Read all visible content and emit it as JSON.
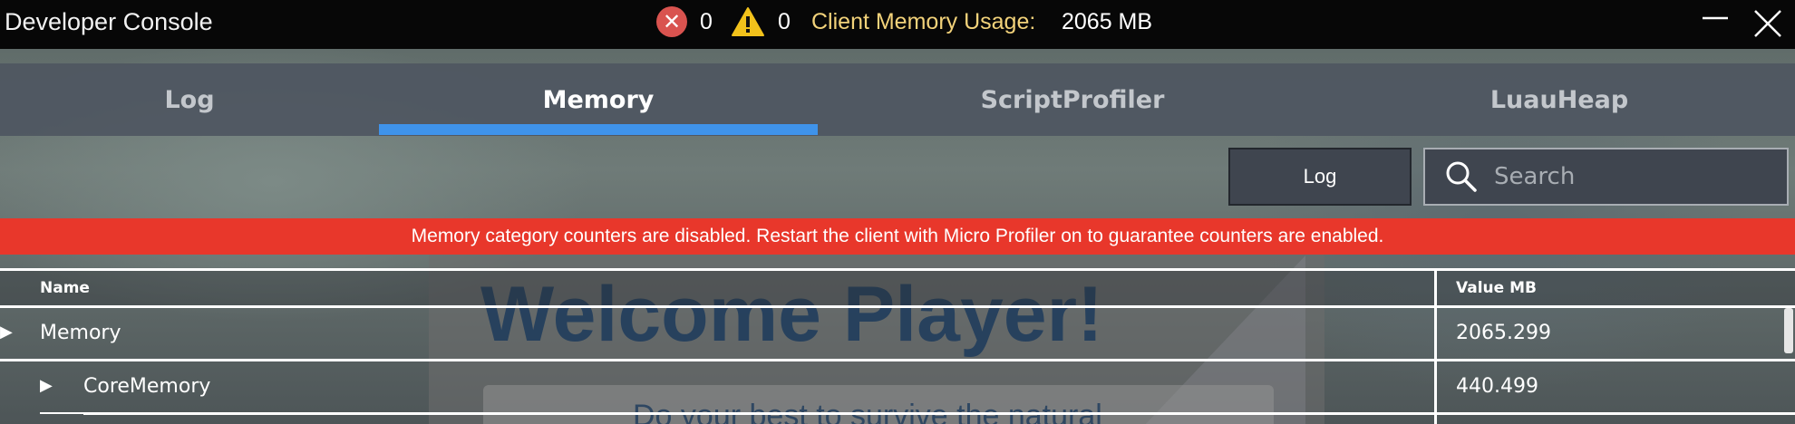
{
  "window": {
    "title": "Developer Console",
    "error_count": "0",
    "warning_count": "0",
    "memory_label": "Client Memory Usage:",
    "memory_value": "2065 MB"
  },
  "tabs": [
    {
      "label": "Log",
      "active": false
    },
    {
      "label": "Memory",
      "active": true
    },
    {
      "label": "ScriptProfiler",
      "active": false
    },
    {
      "label": "LuauHeap",
      "active": false
    }
  ],
  "toolbar": {
    "log_button": "Log",
    "search_placeholder": "Search"
  },
  "banner": {
    "text": "Memory category counters are disabled. Restart the client with Micro Profiler on to guarantee counters are enabled."
  },
  "table": {
    "columns": [
      "Name",
      "Value MB"
    ],
    "rows": [
      {
        "name": "Memory",
        "value": "2065.299"
      },
      {
        "name": "CoreMemory",
        "value": "440.499"
      }
    ]
  },
  "background": {
    "title": "Welcome Player!",
    "subtitle": "Do your best to survive the natural"
  },
  "colors": {
    "accent": "#3f93ea",
    "banner": "#e8372b",
    "memory_label": "#f2d27a",
    "error": "#d9534f",
    "warning": "#f2c21b"
  }
}
